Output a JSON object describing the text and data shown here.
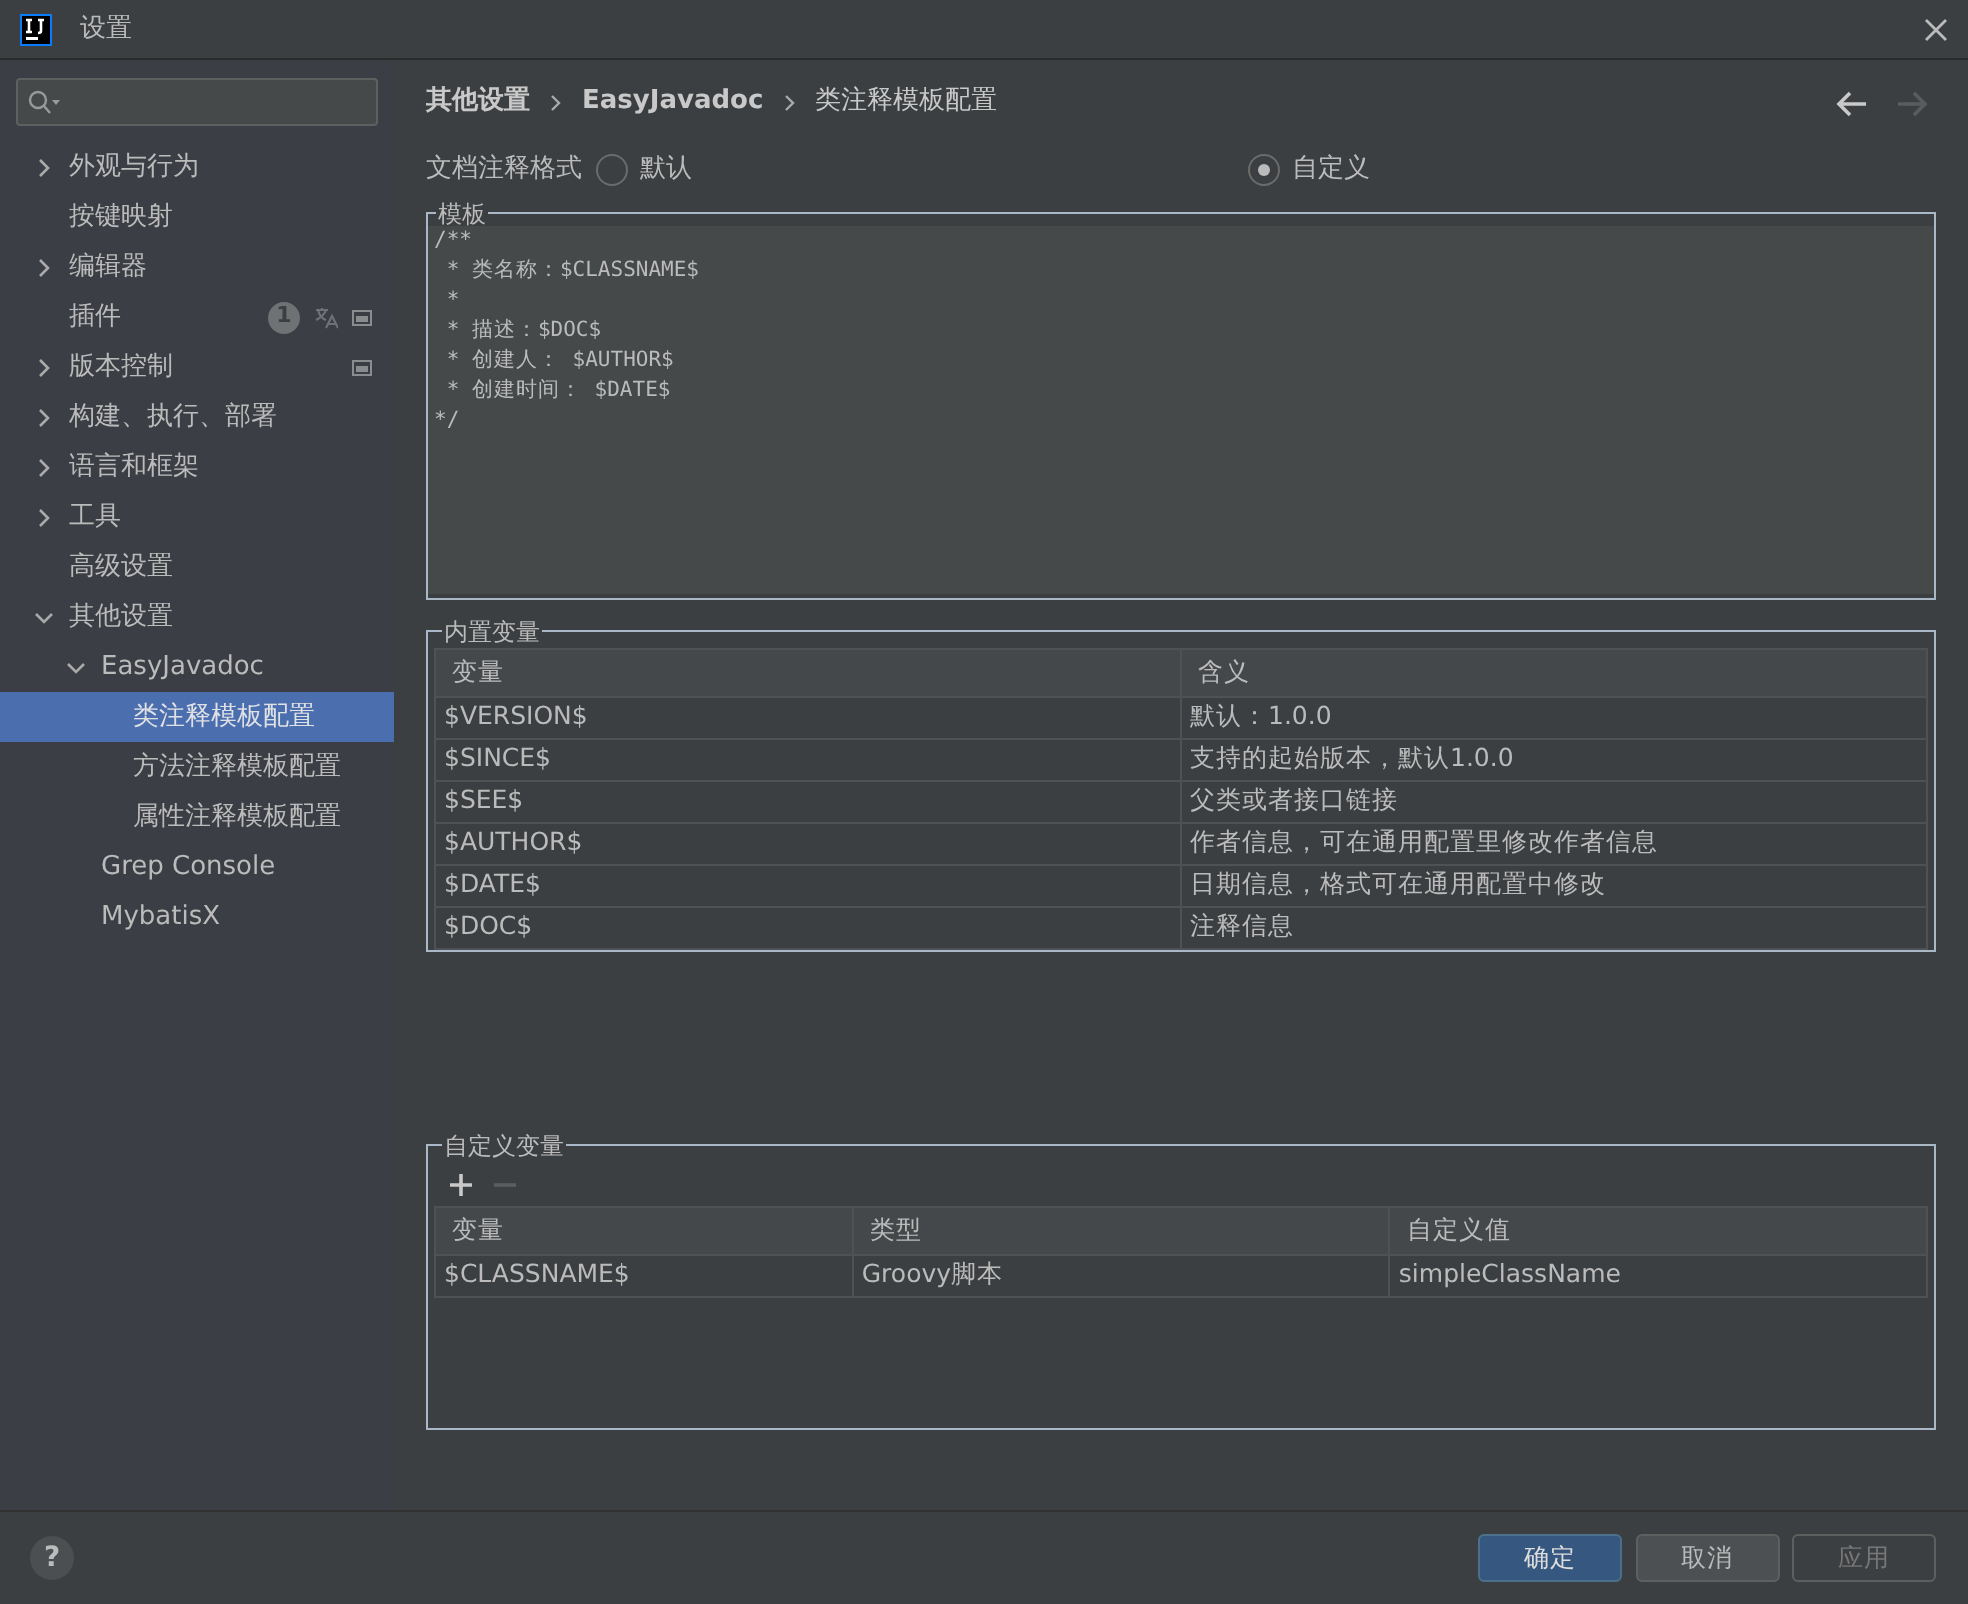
{
  "window": {
    "title": "设置"
  },
  "help": {
    "label": "?"
  },
  "sidebar": {
    "items": [
      {
        "label": "外观与行为",
        "expandable": true,
        "expanded": false,
        "selected": false
      },
      {
        "label": "按键映射",
        "selected": false
      },
      {
        "label": "编辑器",
        "expandable": true,
        "expanded": false,
        "selected": false
      },
      {
        "label": "插件",
        "selected": false,
        "badge": "1",
        "translated": true,
        "project_level": true
      },
      {
        "label": "版本控制",
        "expandable": true,
        "expanded": false,
        "selected": false,
        "project_level": true
      },
      {
        "label": "构建、执行、部署",
        "expandable": true,
        "expanded": false,
        "selected": false
      },
      {
        "label": "语言和框架",
        "expandable": true,
        "expanded": false,
        "selected": false
      },
      {
        "label": "工具",
        "expandable": true,
        "expanded": false,
        "selected": false
      },
      {
        "label": "高级设置",
        "selected": false
      },
      {
        "label": "其他设置",
        "expandable": true,
        "expanded": true,
        "selected": false,
        "children": [
          {
            "label": "EasyJavadoc",
            "expandable": true,
            "expanded": true,
            "selected": false,
            "children": [
              {
                "label": "类注释模板配置",
                "selected": true
              },
              {
                "label": "方法注释模板配置",
                "selected": false
              },
              {
                "label": "属性注释模板配置",
                "selected": false
              }
            ]
          },
          {
            "label": "Grep Console",
            "selected": false
          },
          {
            "label": "MybatisX",
            "selected": false
          }
        ]
      }
    ]
  },
  "breadcrumb": [
    "其他设置",
    "EasyJavadoc",
    "类注释模板配置"
  ],
  "nav": {
    "back_disabled": false,
    "forward_disabled": true
  },
  "format": {
    "label": "文档注释格式",
    "options": [
      {
        "label": "默认",
        "selected": false
      },
      {
        "label": "自定义",
        "selected": true
      }
    ]
  },
  "template": {
    "title": "模板",
    "value": "/**\n * 类名称：$CLASSNAME$\n *\n * 描述：$DOC$\n * 创建人： $AUTHOR$\n * 创建时间： $DATE$\n*/"
  },
  "builtin": {
    "title": "内置变量",
    "columns": [
      "变量",
      "含义"
    ],
    "rows": [
      [
        "$VERSION$",
        "默认：1.0.0"
      ],
      [
        "$SINCE$",
        "支持的起始版本，默认1.0.0"
      ],
      [
        "$SEE$",
        "父类或者接口链接"
      ],
      [
        "$AUTHOR$",
        "作者信息，可在通用配置里修改作者信息"
      ],
      [
        "$DATE$",
        "日期信息，格式可在通用配置中修改"
      ],
      [
        "$DOC$",
        "注释信息"
      ]
    ]
  },
  "custom": {
    "title": "自定义变量",
    "add_disabled": false,
    "remove_disabled": true,
    "columns": [
      "变量",
      "类型",
      "自定义值"
    ],
    "rows": [
      [
        "$CLASSNAME$",
        "Groovy脚本",
        "simpleClassName"
      ]
    ]
  },
  "buttons": [
    {
      "label": "确定",
      "kind": "primary",
      "disabled": false
    },
    {
      "label": "取消",
      "kind": "normal",
      "disabled": false
    },
    {
      "label": "应用",
      "kind": "normal",
      "disabled": true
    }
  ]
}
